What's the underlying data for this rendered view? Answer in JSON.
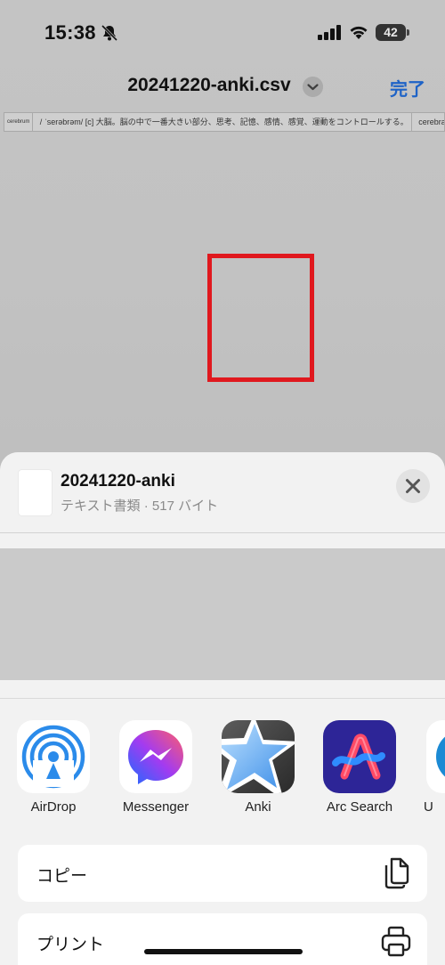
{
  "status": {
    "time": "15:38",
    "battery": "42"
  },
  "nav": {
    "title": "20241220-anki.csv",
    "done_label": "完了"
  },
  "csv_preview": {
    "cells": [
      "cerebrum",
      "/ ˈserəbrəm/ [c] 大脳。脳の中で一番大きい部分、思考、記憶、感情、感覚、運動をコントロールする。",
      "cerebral c"
    ]
  },
  "share_sheet": {
    "file_name": "20241220-anki",
    "file_meta": "テキスト書類 · 517 バイト",
    "apps": [
      {
        "label": "AirDrop",
        "icon": "airdrop-icon"
      },
      {
        "label": "Messenger",
        "icon": "messenger-icon"
      },
      {
        "label": "Anki",
        "icon": "anki-icon"
      },
      {
        "label": "Arc Search",
        "icon": "arc-search-icon"
      },
      {
        "label": "U",
        "icon": "partial-app-icon"
      }
    ],
    "actions": [
      {
        "label": "コピー",
        "icon": "copy-icon"
      },
      {
        "label": "プリント",
        "icon": "print-icon"
      }
    ],
    "highlight_color": "#e0181e"
  }
}
